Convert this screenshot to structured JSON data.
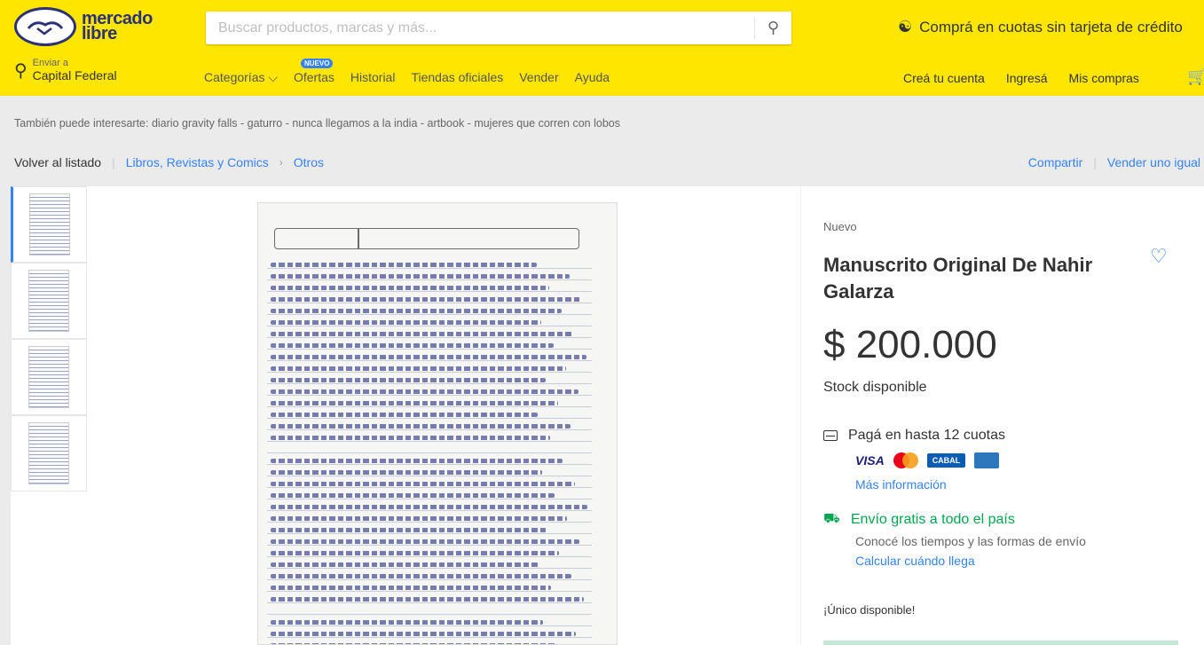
{
  "header": {
    "logo_text_1": "mercado",
    "logo_text_2": "libre",
    "search_placeholder": "Buscar productos, marcas y más...",
    "promo_text": "Comprá en cuotas sin tarjeta de crédito",
    "location_label": "Enviar a",
    "location_value": "Capital Federal",
    "nav": [
      {
        "label": "Categorías ⌵"
      },
      {
        "label": "Ofertas",
        "badge": "NUEVO"
      },
      {
        "label": "Historial"
      },
      {
        "label": "Tiendas oficiales"
      },
      {
        "label": "Vender"
      },
      {
        "label": "Ayuda"
      }
    ],
    "user_nav": [
      "Creá tu cuenta",
      "Ingresá",
      "Mis compras"
    ]
  },
  "also_interest": "También puede interesarte: diario gravity falls - gaturro - nunca llegamos a la india - artbook - mujeres que corren con lobos",
  "breadcrumb": {
    "back": "Volver al listado",
    "items": [
      "Libros, Revistas y Comics",
      "Otros"
    ]
  },
  "actions": {
    "share": "Compartir",
    "sell_same": "Vender uno igual"
  },
  "product": {
    "condition": "Nuevo",
    "title": "Manuscrito Original De Nahir Galarza",
    "price": "$ 200.000",
    "stock": "Stock disponible",
    "payment_text": "Pagá en hasta 12 cuotas",
    "payment_cards": [
      "VISA",
      "CABAL"
    ],
    "more_info": "Más información",
    "shipping_title": "Envío gratis a todo el país",
    "shipping_sub": "Conocé los tiempos y las formas de envío",
    "shipping_calc": "Calcular cuándo llega",
    "unique": "¡Único disponible!"
  },
  "colors": {
    "header_bg": "#ffe600",
    "link": "#3483fa",
    "green": "#00a650"
  }
}
